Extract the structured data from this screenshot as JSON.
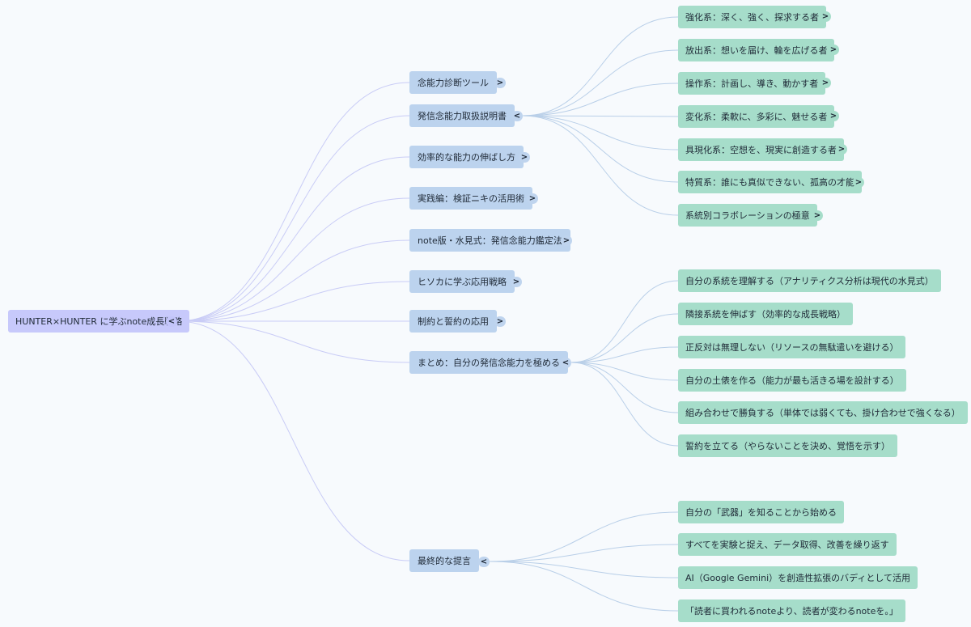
{
  "root": {
    "label": "HUNTER×HUNTER に学ぶnote成長戦略",
    "toggle": "<"
  },
  "branches": [
    {
      "label": "念能力診断ツール",
      "toggle": ">"
    },
    {
      "label": "発信念能力取扱説明書",
      "toggle": "<"
    },
    {
      "label": "効率的な能力の伸ばし方",
      "toggle": ">"
    },
    {
      "label": "実践編：検証ニキの活用術",
      "toggle": ">"
    },
    {
      "label": "note版・水見式：発信念能力鑑定法",
      "toggle": ">"
    },
    {
      "label": "ヒソカに学ぶ応用戦略",
      "toggle": ">"
    },
    {
      "label": "制約と誓約の応用",
      "toggle": ">"
    },
    {
      "label": "まとめ：自分の発信念能力を極める",
      "toggle": "<"
    },
    {
      "label": "最終的な提言",
      "toggle": "<"
    }
  ],
  "nen_types": [
    {
      "label": "強化系：深く、強く、探求する者",
      "toggle": ">"
    },
    {
      "label": "放出系：想いを届け、輪を広げる者",
      "toggle": ">"
    },
    {
      "label": "操作系：計画し、導き、動かす者",
      "toggle": ">"
    },
    {
      "label": "変化系：柔軟に、多彩に、魅せる者",
      "toggle": ">"
    },
    {
      "label": "具現化系：空想を、現実に創造する者",
      "toggle": ">"
    },
    {
      "label": "特質系：誰にも真似できない、孤高の才能",
      "toggle": ">"
    },
    {
      "label": "系統別コラボレーションの極意",
      "toggle": ">"
    }
  ],
  "summary_items": [
    "自分の系統を理解する（アナリティクス分析は現代の水見式）",
    "隣接系統を伸ばす（効率的な成長戦略）",
    "正反対は無理しない（リソースの無駄遣いを避ける）",
    "自分の土俵を作る（能力が最も活きる場を設計する）",
    "組み合わせで勝負する（単体では弱くても、掛け合わせで強くなる）",
    "誓約を立てる（やらないことを決め、覚悟を示す）"
  ],
  "final_items": [
    "自分の「武器」を知ることから始める",
    "すべてを実験と捉え、データ取得、改善を繰り返す",
    "AI（Google Gemini）を創造性拡張のバディとして活用",
    "「読者に買われるnoteより、読者が変わるnoteを。」"
  ],
  "colors": {
    "background": "#f7fafd",
    "root": "#c7c9fb",
    "branch": "#bcd3ee",
    "leaf": "#a6ddca",
    "edge_root": "#c9ccf6",
    "edge_child": "#b9cfe8"
  }
}
